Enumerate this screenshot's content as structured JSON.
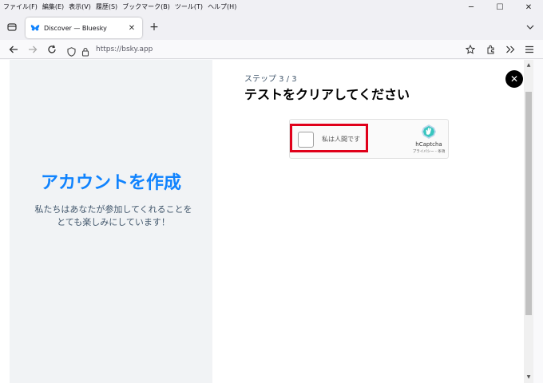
{
  "menubar": {
    "items": [
      "ファイル(F)",
      "編集(E)",
      "表示(V)",
      "履歴(S)",
      "ブックマーク(B)",
      "ツール(T)",
      "ヘルプ(H)"
    ],
    "minimize": "─",
    "maximize": "☐",
    "close": "✕"
  },
  "tabs": {
    "active_title": "Discover — Bluesky",
    "close": "✕",
    "new_tab": "+"
  },
  "navbar": {
    "url": "https://bsky.app"
  },
  "left_panel": {
    "headline": "アカウントを作成",
    "subtext": "私たちはあなたが参加してくれることをとても楽しみにしています！"
  },
  "dialog": {
    "step": "ステップ 3 / 3",
    "title": "テストをクリアしてください",
    "close": "✕"
  },
  "captcha": {
    "label": "私は人間です",
    "brand": "hCaptcha",
    "legal": "プライバシー - 条項"
  },
  "colors": {
    "accent": "#1083fe",
    "highlight": "#e0001a"
  }
}
